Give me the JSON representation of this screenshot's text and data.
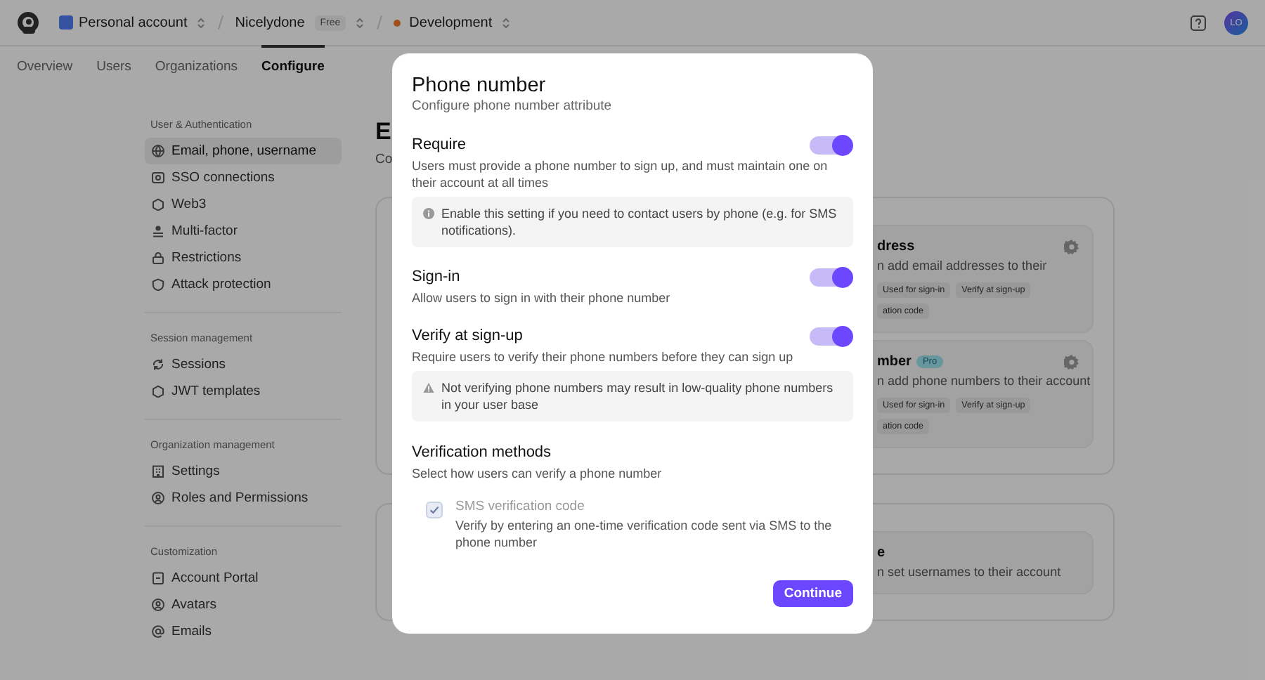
{
  "top_bar": {
    "breadcrumbs": [
      {
        "kind": "account",
        "label": "Personal account"
      },
      {
        "kind": "app",
        "label": "Nicelydone",
        "badge": "Free"
      },
      {
        "kind": "instance",
        "label": "Development"
      }
    ],
    "user_initials": "LO"
  },
  "tabs": [
    {
      "label": "Overview",
      "selected": false
    },
    {
      "label": "Users",
      "selected": false
    },
    {
      "label": "Organizations",
      "selected": false
    },
    {
      "label": "Configure",
      "selected": true
    }
  ],
  "sidebar": {
    "sections": [
      {
        "title": "User & Authentication",
        "items": [
          {
            "label": "Email, phone, username",
            "selected": true
          },
          {
            "label": "SSO connections",
            "selected": false
          },
          {
            "label": "Web3",
            "selected": false
          },
          {
            "label": "Multi-factor",
            "selected": false
          },
          {
            "label": "Restrictions",
            "selected": false
          },
          {
            "label": "Attack protection",
            "selected": false
          }
        ]
      },
      {
        "title": "Session management",
        "items": [
          {
            "label": "Sessions",
            "selected": false
          },
          {
            "label": "JWT templates",
            "selected": false
          }
        ]
      },
      {
        "title": "Organization management",
        "items": [
          {
            "label": "Settings",
            "selected": false
          },
          {
            "label": "Roles and Permissions",
            "selected": false
          }
        ]
      },
      {
        "title": "Customization",
        "items": [
          {
            "label": "Account Portal",
            "selected": false
          },
          {
            "label": "Avatars",
            "selected": false
          },
          {
            "label": "Emails",
            "selected": false
          }
        ]
      }
    ]
  },
  "main": {
    "title": "E",
    "subtitle": "Co",
    "cards": [
      {
        "items": [
          {
            "title": "dress",
            "description": "n add email addresses to their",
            "tags": [
              "Used for sign-in",
              "Verify at sign-up",
              "ation code"
            ]
          },
          {
            "title": "mber",
            "badge": "Pro",
            "description": "n add phone numbers to their account",
            "tags": [
              "Used for sign-in",
              "Verify at sign-up",
              "ation code"
            ]
          }
        ]
      },
      {
        "items": [
          {
            "title": "e",
            "description": "n set usernames to their account"
          }
        ]
      }
    ]
  },
  "modal": {
    "title": "Phone number",
    "subtitle": "Configure phone number attribute",
    "settings": [
      {
        "title": "Require",
        "description": "Users must provide a phone number to sign up, and must maintain one on their account at all times",
        "on": true,
        "note": {
          "kind": "info",
          "text": "Enable this setting if you need to contact users by phone (e.g. for SMS notifications)."
        }
      },
      {
        "title": "Sign-in",
        "description": "Allow users to sign in with their phone number",
        "on": true
      },
      {
        "title": "Verify at sign-up",
        "description": "Require users to verify their phone numbers before they can sign up",
        "on": true,
        "note": {
          "kind": "warning",
          "text": "Not verifying phone numbers may result in low-quality phone numbers in your user base"
        }
      }
    ],
    "methods": {
      "title": "Verification methods",
      "description": "Select how users can verify a phone number",
      "options": [
        {
          "label": "SMS verification code",
          "description": "Verify by entering an one-time verification code sent via SMS to the phone number",
          "checked": true,
          "disabled": true
        }
      ]
    },
    "button": "Continue"
  }
}
